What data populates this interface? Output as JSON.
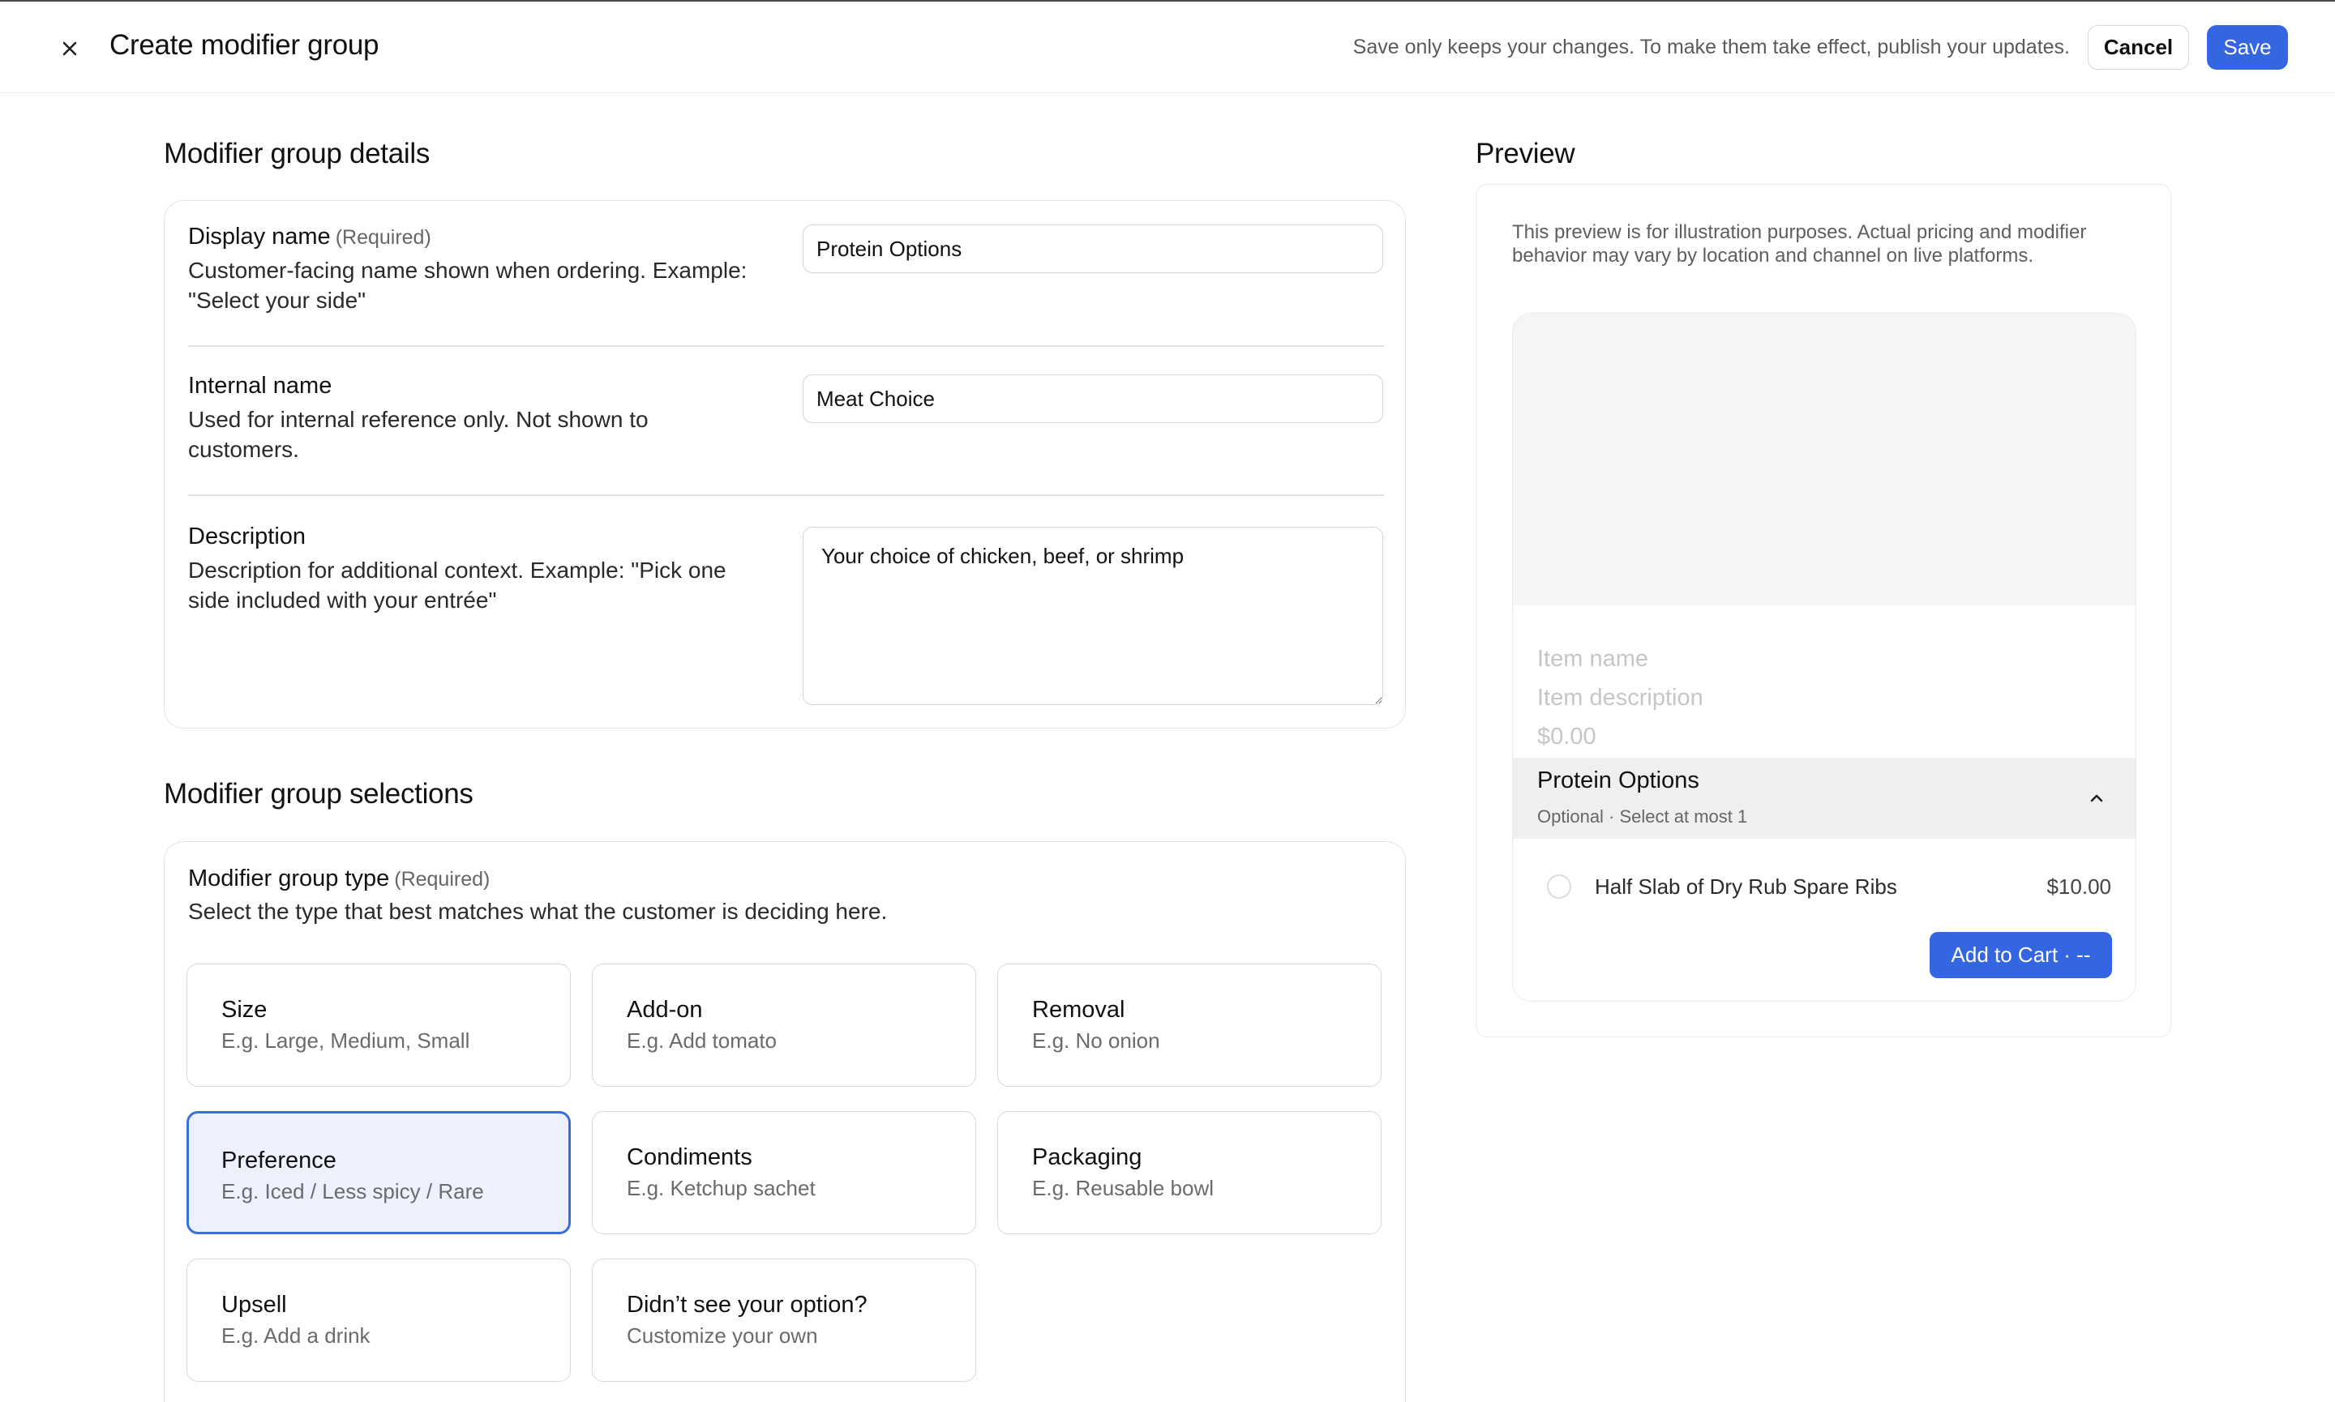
{
  "header": {
    "close_icon": "close-icon",
    "title": "Create modifier group",
    "save_note": "Save only keeps your changes. To make them take effect, publish your updates.",
    "cancel_label": "Cancel",
    "save_label": "Save"
  },
  "details": {
    "heading": "Modifier group details",
    "display_name": {
      "label": "Display name",
      "required": "(Required)",
      "help": "Customer-facing name shown when ordering. Example: \"Select your side\"",
      "value": "Protein Options"
    },
    "internal_name": {
      "label": "Internal name",
      "help": "Used for internal reference only. Not shown to customers.",
      "value": "Meat Choice"
    },
    "description": {
      "label": "Description",
      "help": "Description for additional context. Example: \"Pick one side included with your entrée\"",
      "value": "Your choice of chicken, beef, or shrimp"
    }
  },
  "selections": {
    "heading": "Modifier group selections",
    "type_label": "Modifier group type",
    "type_required": "(Required)",
    "type_help": "Select the type that best matches what the customer is deciding here.",
    "options": [
      {
        "title": "Size",
        "sub": "E.g. Large, Medium, Small"
      },
      {
        "title": "Add-on",
        "sub": "E.g. Add tomato"
      },
      {
        "title": "Removal",
        "sub": "E.g. No onion"
      },
      {
        "title": "Preference",
        "sub": "E.g. Iced / Less spicy / Rare"
      },
      {
        "title": "Condiments",
        "sub": "E.g. Ketchup sachet"
      },
      {
        "title": "Packaging",
        "sub": "E.g. Reusable bowl"
      },
      {
        "title": "Upsell",
        "sub": "E.g. Add a drink"
      },
      {
        "title": "Didn’t see your option?",
        "sub": "Customize your own"
      }
    ],
    "selected": "Preference"
  },
  "preview": {
    "heading": "Preview",
    "note": "This preview is for illustration purposes. Actual pricing and modifier behavior may vary by location and channel on live platforms.",
    "item_name_placeholder": "Item name",
    "item_description_placeholder": "Item description",
    "price_placeholder": "$0.00",
    "group_title": "Protein Options",
    "group_sub": "Optional · Select at most 1",
    "option_name": "Half Slab of Dry Rub Spare Ribs",
    "option_price": "$10.00",
    "add_to_cart": "Add to Cart · --",
    "chevron_icon": "chevron-up-icon"
  },
  "colors": {
    "accent": "#3366e0",
    "selected_border": "#3a6ed8",
    "selected_bg": "#ecf1fd"
  }
}
